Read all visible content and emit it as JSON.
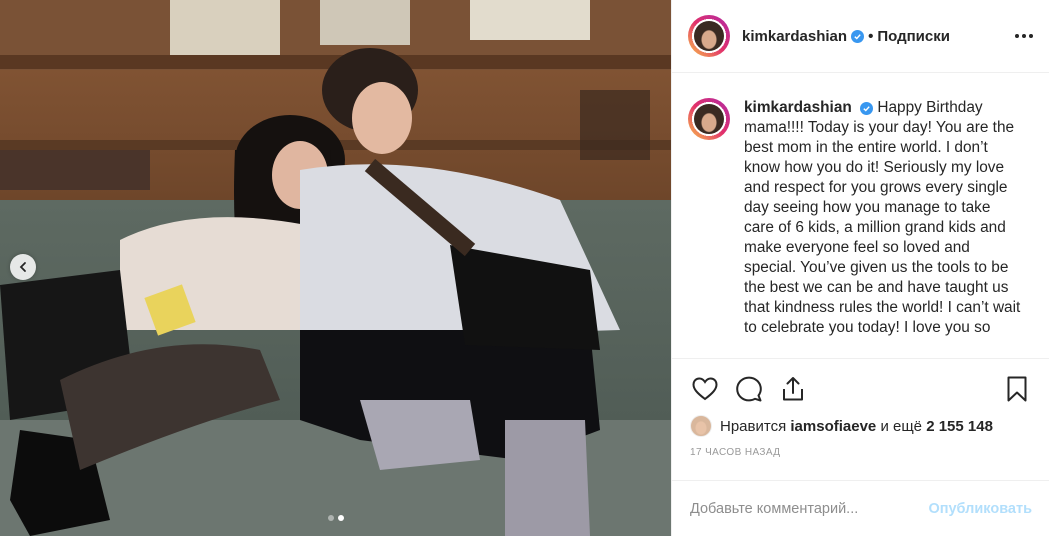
{
  "post": {
    "username": "kimkardashian",
    "dot": "•",
    "follow_label": "Подписки",
    "caption": "Happy Birthday mama!!!! Today is your day! You are the best mom in the entire world. I don’t know how you do it! Seriously my love and respect for you grows every single day seeing how you manage to take care of 6 kids, a million grand kids and make everyone feel so loved and special. You’ve given us the tools to be the best we can be and have taught us that kindness rules the world! I can’t wait to celebrate you today! I love you so",
    "likes": {
      "prefix": "Нравится",
      "liker": "iamsofiaeve",
      "joiner": "и ещё",
      "count": "2 155 148"
    },
    "timestamp": "17 часов назад",
    "comment_placeholder": "Добавьте комментарий...",
    "publish_label": "Опубликовать"
  },
  "carousel": {
    "slides": 2,
    "active_index": 1
  },
  "icons": {
    "verified": "verified-badge-icon",
    "more": "more-horizontal-icon",
    "like": "heart-icon",
    "comment": "comment-bubble-icon",
    "share": "share-icon",
    "save": "bookmark-icon",
    "prev": "chevron-left-icon"
  },
  "colors": {
    "verified_blue": "#3897f0",
    "publish_disabled": "#b2dffc",
    "muted_text": "#999999"
  }
}
